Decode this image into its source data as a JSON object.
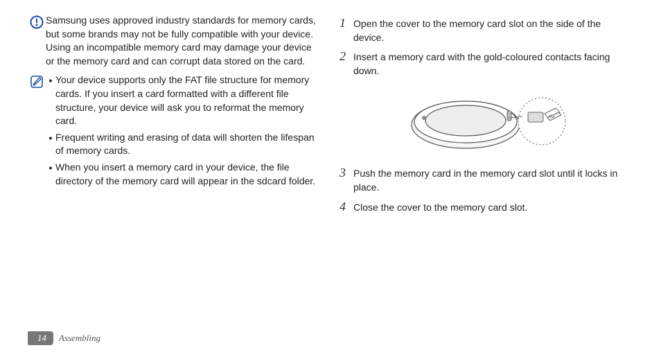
{
  "left": {
    "warning": "Samsung uses approved industry standards for memory cards, but some brands may not be fully compatible with your device. Using an incompatible memory card may damage your device or the memory card and can corrupt data stored on the card.",
    "notes": [
      "Your device supports only the FAT file structure for memory cards. If you insert a card formatted with a different file structure, your device will ask you to reformat the memory card.",
      "Frequent writing and erasing of data will shorten the lifespan of memory cards.",
      "When you insert a memory card in your device, the file directory of the memory card will appear in the sdcard folder."
    ]
  },
  "right": {
    "steps": [
      {
        "n": "1",
        "t": "Open the cover to the memory card slot on the side of the device."
      },
      {
        "n": "2",
        "t": "Insert a memory card with the gold-coloured contacts facing down."
      },
      {
        "n": "3",
        "t": "Push the memory card in the memory card slot until it locks in place."
      },
      {
        "n": "4",
        "t": "Close the cover to the memory card slot."
      }
    ]
  },
  "footer": {
    "page": "14",
    "section": "Assembling"
  }
}
